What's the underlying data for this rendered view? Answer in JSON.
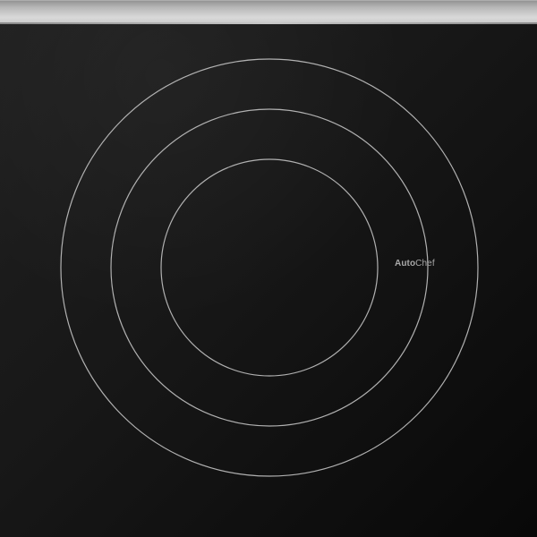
{
  "scene": {
    "trim_color": "#c8c8c8",
    "surface_color": "#111111",
    "ring_color": "#b9b9b9"
  },
  "brand": {
    "auto": "Auto",
    "chef": "Chef"
  }
}
